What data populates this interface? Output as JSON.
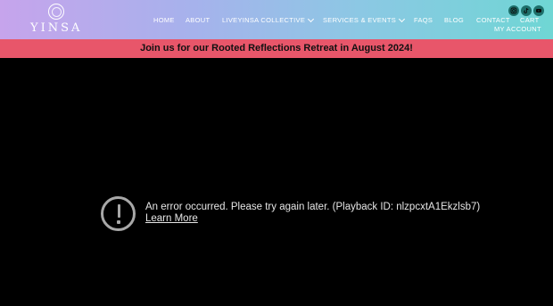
{
  "header": {
    "logo_text": "YINSA",
    "nav": [
      {
        "label": "HOME",
        "dropdown": false
      },
      {
        "label": "ABOUT",
        "dropdown": false
      },
      {
        "label": "LIVEYINSA COLLECTIVE",
        "dropdown": true
      },
      {
        "label": "SERVICES & EVENTS",
        "dropdown": true
      },
      {
        "label": "FAQS",
        "dropdown": false
      },
      {
        "label": "BLOG",
        "dropdown": false
      },
      {
        "label": "CONTACT",
        "dropdown": false
      },
      {
        "label": "CART",
        "dropdown": false
      }
    ],
    "account_label": "MY ACCOUNT",
    "social_icons": [
      "instagram-icon",
      "tiktok-icon",
      "youtube-icon"
    ],
    "gradient_colors": [
      "#c6a4ec",
      "#6fd6d4"
    ]
  },
  "banner": {
    "text": "Join us for our Rooted Reflections Retreat in August 2024!",
    "color": "#e8566a"
  },
  "player": {
    "error_message": "An error occurred. Please try again later. (Playback ID: nlzpcxtA1Ekzlsb7)",
    "learn_more_label": "Learn More"
  }
}
